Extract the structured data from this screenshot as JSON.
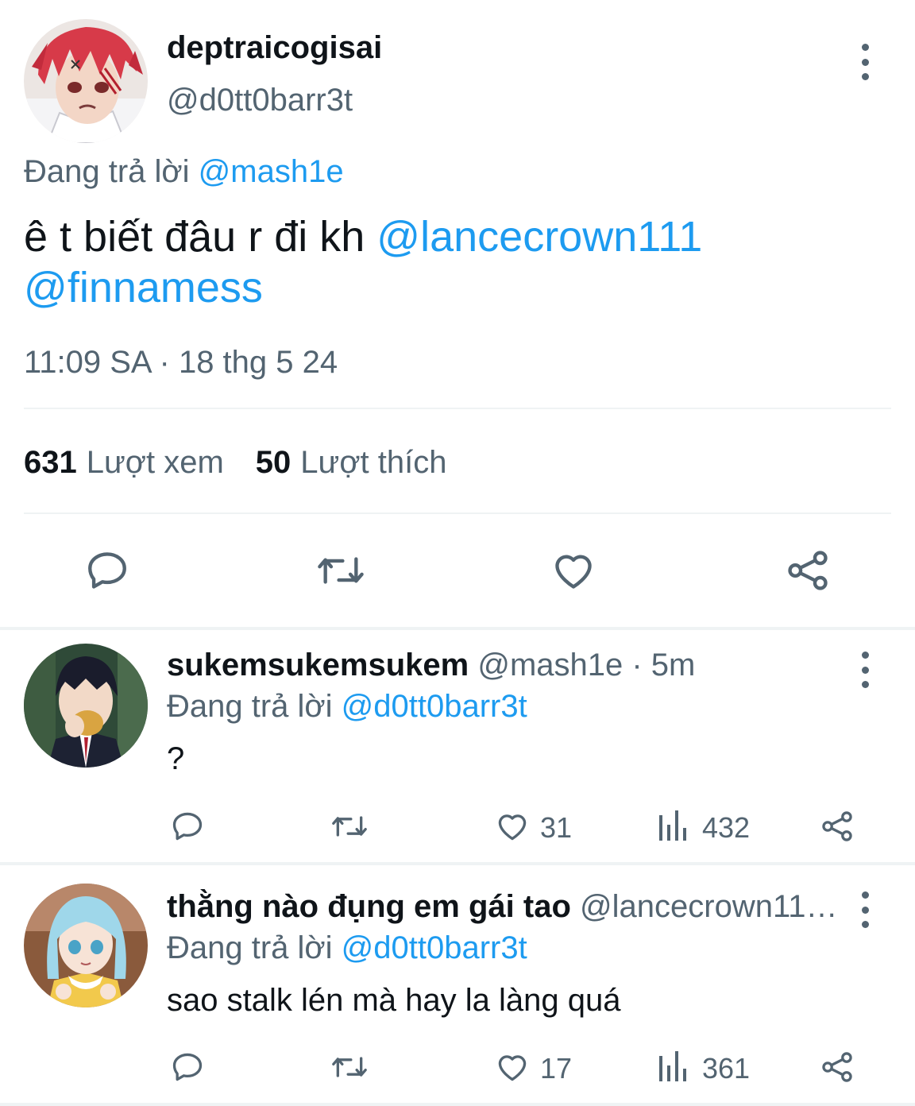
{
  "colors": {
    "text": "#0f1419",
    "secondary": "#536471",
    "link": "#1d9bf0",
    "divider": "#eff3f4"
  },
  "main_tweet": {
    "avatar": "red-haired-anime-avatar",
    "display_name": "deptraicogisai",
    "handle": "@d0tt0barr3t",
    "replying_prefix": "Đang trả lời",
    "replying_to": "@mash1e",
    "text": "ê t biết đâu r đi kh",
    "mention_1": "@lancecrown111",
    "mention_2": "@finnamess",
    "timestamp": "11:09 SA · 18 thg 5 24",
    "views_count": "631",
    "views_label": "Lượt xem",
    "likes_count": "50",
    "likes_label": "Lượt thích",
    "actions": [
      "reply-icon",
      "retweet-icon",
      "like-icon",
      "share-icon"
    ]
  },
  "replies": [
    {
      "avatar": "dark-haired-anime-avatar",
      "display_name": "sukemsukemsukem",
      "meta": "@mash1e · 5m",
      "replying_prefix": "Đang trả lời",
      "replying_to": "@d0tt0barr3t",
      "text": "?",
      "likes": "31",
      "views": "432"
    },
    {
      "avatar": "blue-haired-anime-avatar",
      "display_name": "thằng nào đụng em gái tao",
      "meta": "@lancecrown11…",
      "replying_prefix": "Đang trả lời",
      "replying_to": "@d0tt0barr3t",
      "text": "sao stalk lén mà hay la làng quá",
      "likes": "17",
      "views": "361"
    }
  ]
}
